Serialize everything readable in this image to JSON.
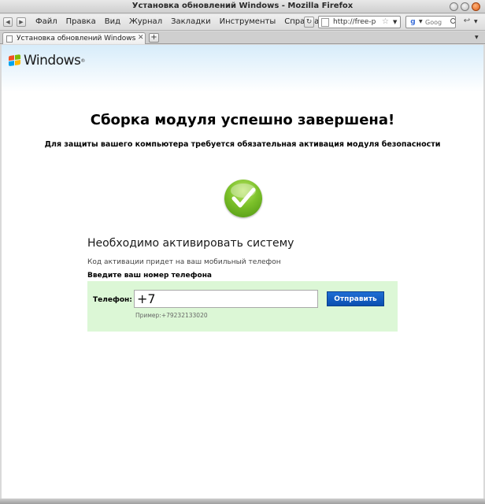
{
  "window": {
    "title": "Установка обновлений Windows - Mozilla Firefox"
  },
  "toolbar": {
    "menu": [
      "Файл",
      "Правка",
      "Вид",
      "Журнал",
      "Закладки",
      "Инструменты",
      "Справка"
    ],
    "url": "http://free-p",
    "search_placeholder": "Goog"
  },
  "tabs": {
    "active_label": "Установка обновлений Windows",
    "new_tab": "+"
  },
  "page": {
    "logo_text": "Windows",
    "headline": "Сборка модуля успешно завершена!",
    "subhead": "Для защиты вашего компьютера требуется обязательная активация модуля безопасности",
    "activate_title": "Необходимо активировать систему",
    "activate_note": "Код активации придет на ваш мобильный телефон",
    "phone_prompt": "Введите ваш номер телефона",
    "form": {
      "phone_label": "Телефон:",
      "phone_value": "+7",
      "submit_label": "Отправить",
      "example": "Пример:+79232133020"
    }
  },
  "icons": {
    "back": "back-icon",
    "forward": "forward-icon",
    "reload": "reload-icon",
    "check": "checkmark-icon"
  },
  "colors": {
    "form_bg": "#dcf7d6",
    "button": "#0a4fb0",
    "check_green": "#7cc12a"
  }
}
